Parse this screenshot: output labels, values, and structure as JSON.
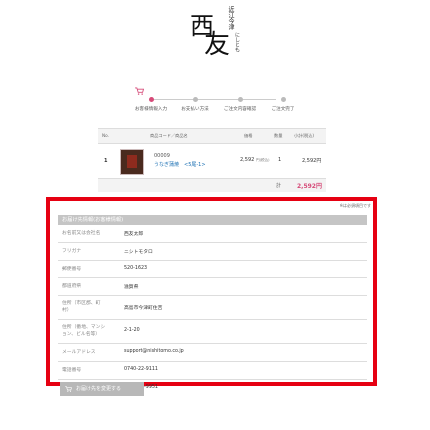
{
  "logo": {
    "small_text": "近江今津",
    "mark_top": "西",
    "mark_bottom": "友",
    "reading": "にしとも"
  },
  "steps": [
    {
      "label": "お客様情報入力",
      "active": true
    },
    {
      "label": "お支払い方法",
      "active": false
    },
    {
      "label": "ご注文内容確認",
      "active": false
    },
    {
      "label": "ご注文完了",
      "active": false
    }
  ],
  "cart": {
    "headers": {
      "no": "No.",
      "product": "商品コード／商品名",
      "price": "価格",
      "qty": "数量",
      "subtotal": "小計(税込)"
    },
    "items": [
      {
        "no": "1",
        "code": "00009",
        "name": "うなぎ蒲焼　<5尾-1>",
        "price": "2,592",
        "tax_note": "円(税込)",
        "qty": "1",
        "subtotal": "2,592円"
      }
    ],
    "total_label": "計",
    "total_value": "2,592円"
  },
  "shipping": {
    "required_note": "※は必須項目です",
    "title": "お届け先情報(お客様情報)",
    "rows": [
      {
        "key": "お名前又は会社名",
        "value": "西友太郎"
      },
      {
        "key": "フリガナ",
        "value": "ニシトモタロ"
      },
      {
        "key": "郵便番号",
        "value": "520-1623"
      },
      {
        "key": "都道府県",
        "value": "滋賀県"
      },
      {
        "key": "住所（市区郡、町村）",
        "value": "高島市今津町住吉"
      },
      {
        "key": "住所（番地、マンション、ビル名等）",
        "value": "2-1-20"
      },
      {
        "key": "メールアドレス",
        "value": "support@nishitomo.co.jp"
      },
      {
        "key": "電話番号",
        "value": "0740-22-9111"
      },
      {
        "key": "FAX番号",
        "value": "0740-22-9951"
      }
    ]
  },
  "confirm_button": "お届け先を変更する",
  "colors": {
    "accent": "#d64a78",
    "highlight": "#e60012",
    "total": "#d64a78"
  }
}
